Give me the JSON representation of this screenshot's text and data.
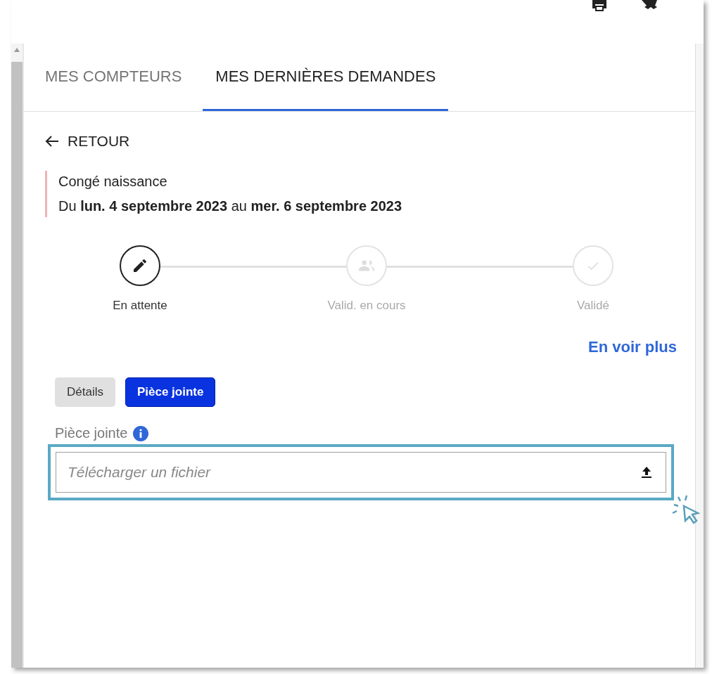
{
  "tabs": [
    {
      "label": "MES COMPTEURS",
      "selected": false
    },
    {
      "label": "MES DERNIÈRES DEMANDES",
      "selected": true
    }
  ],
  "back": {
    "label": "RETOUR"
  },
  "request": {
    "type": "Congé naissance",
    "period": "Du **lun. 4 septembre 2023** au **mer. 6 septembre 2023**"
  },
  "steps": [
    {
      "kind": "edit",
      "label": "En attente",
      "active": true
    },
    {
      "kind": "people",
      "label": "Valid. en cours",
      "active": false
    },
    {
      "kind": "check",
      "label": "Validé",
      "active": false
    }
  ],
  "more_link": "En voir plus",
  "subtabs": [
    {
      "label": "Détails",
      "selected": false
    },
    {
      "label": "Pièce jointe",
      "selected": true
    }
  ],
  "attachment": {
    "label": "Pièce jointe",
    "placeholder": "Télécharger un fichier",
    "highlighted": true
  }
}
